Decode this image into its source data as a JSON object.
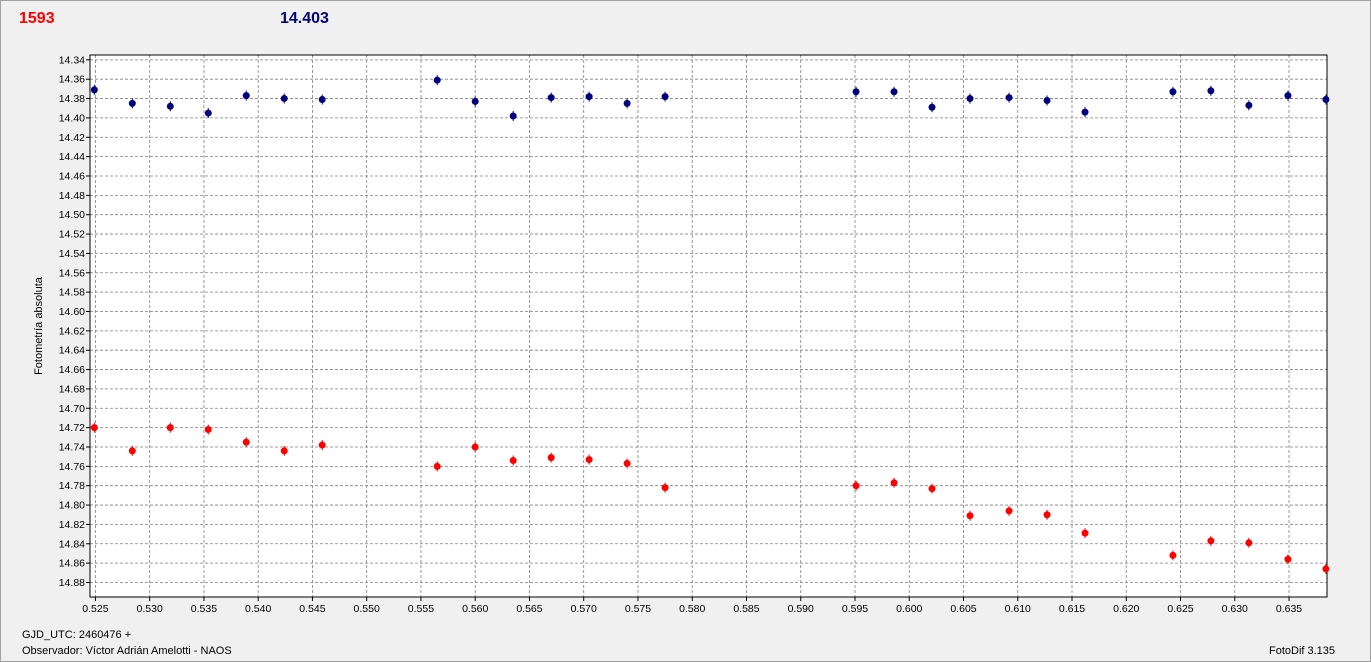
{
  "header": {
    "left_value": "1593",
    "right_value": "14.403"
  },
  "footer": {
    "gjd": "GJD_UTC: 2460476 +",
    "observer": "Observador: Víctor Adrián Amelotti - NAOS",
    "version": "FotoDif 3.135"
  },
  "colors": {
    "series_blue": "#00007f",
    "series_red": "#ff0000",
    "grid": "#808080",
    "plot_bg": "#ffffff",
    "window_bg": "#f0f0f0"
  },
  "chart_data": {
    "type": "scatter",
    "ylabel": "Fotometría absoluta",
    "xlabel": "",
    "xlim": [
      0.5245,
      0.6385
    ],
    "ylim": [
      14.335,
      14.895
    ],
    "y_inverted": true,
    "grid": true,
    "x_ticks": [
      "0.525",
      "0.530",
      "0.535",
      "0.540",
      "0.545",
      "0.550",
      "0.555",
      "0.560",
      "0.565",
      "0.570",
      "0.575",
      "0.580",
      "0.585",
      "0.590",
      "0.595",
      "0.600",
      "0.605",
      "0.610",
      "0.615",
      "0.620",
      "0.625",
      "0.630",
      "0.635"
    ],
    "y_ticks": [
      "14.34",
      "14.36",
      "14.38",
      "14.40",
      "14.42",
      "14.44",
      "14.46",
      "14.48",
      "14.50",
      "14.52",
      "14.54",
      "14.56",
      "14.58",
      "14.60",
      "14.62",
      "14.64",
      "14.66",
      "14.68",
      "14.70",
      "14.72",
      "14.74",
      "14.76",
      "14.78",
      "14.80",
      "14.82",
      "14.84",
      "14.86",
      "14.88"
    ],
    "series": [
      {
        "color": "#00007f",
        "x": [
          0.5249,
          0.5284,
          0.5319,
          0.5354,
          0.5389,
          0.5424,
          0.5459,
          0.5565,
          0.56,
          0.5635,
          0.567,
          0.5705,
          0.574,
          0.5775,
          0.5951,
          0.5986,
          0.6021,
          0.6056,
          0.6092,
          0.6127,
          0.6162,
          0.6243,
          0.6278,
          0.6313,
          0.6349,
          0.6384
        ],
        "y": [
          14.371,
          14.385,
          14.388,
          14.395,
          14.377,
          14.38,
          14.381,
          14.361,
          14.383,
          14.398,
          14.379,
          14.378,
          14.385,
          14.378,
          14.373,
          14.373,
          14.389,
          14.38,
          14.379,
          14.382,
          14.394,
          14.373,
          14.372,
          14.387,
          14.377,
          14.381
        ]
      },
      {
        "color": "#ff0000",
        "x": [
          0.5249,
          0.5284,
          0.5319,
          0.5354,
          0.5389,
          0.5424,
          0.5459,
          0.5565,
          0.56,
          0.5635,
          0.567,
          0.5705,
          0.574,
          0.5775,
          0.5951,
          0.5986,
          0.6021,
          0.6056,
          0.6092,
          0.6127,
          0.6162,
          0.6243,
          0.6278,
          0.6313,
          0.6349,
          0.6384
        ],
        "y": [
          14.72,
          14.744,
          14.72,
          14.722,
          14.735,
          14.744,
          14.738,
          14.76,
          14.74,
          14.754,
          14.751,
          14.753,
          14.757,
          14.782,
          14.78,
          14.777,
          14.783,
          14.811,
          14.806,
          14.81,
          14.829,
          14.852,
          14.837,
          14.839,
          14.856,
          14.866
        ]
      }
    ]
  }
}
